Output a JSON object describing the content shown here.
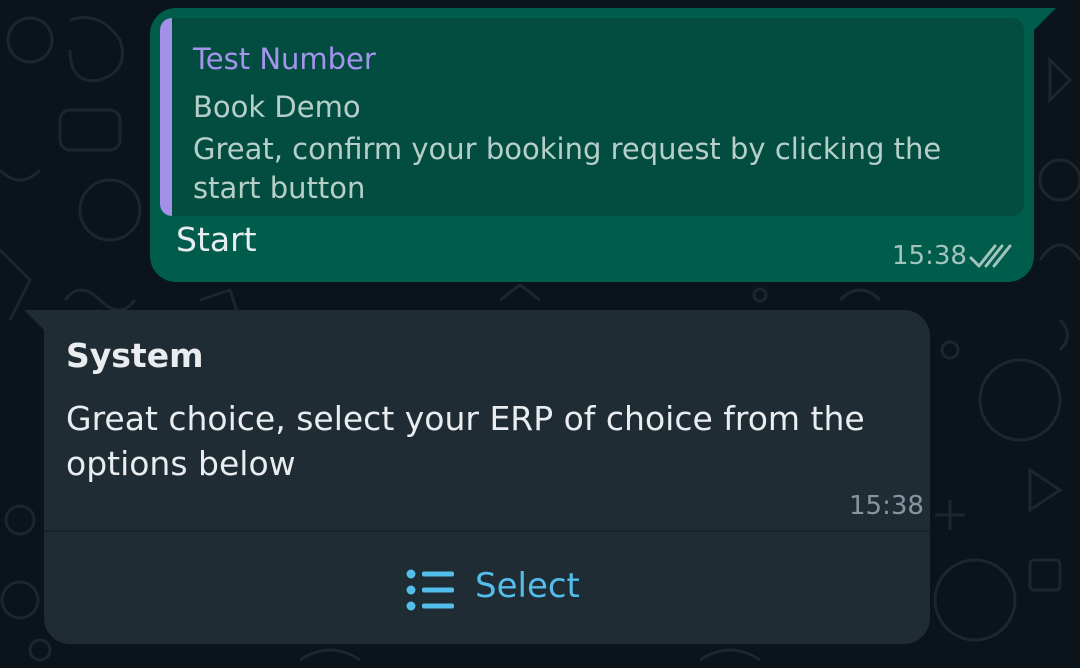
{
  "outgoing": {
    "quote": {
      "author": "Test Number",
      "title": "Book Demo",
      "body": "Great, confirm your booking request by clicking the start button"
    },
    "text": "Start",
    "time": "15:38",
    "status_icon": "double-check-icon"
  },
  "incoming": {
    "sender": "System",
    "text": "Great choice, select your ERP of choice from the options below",
    "time": "15:38",
    "button": {
      "label": "Select",
      "icon": "list-icon"
    }
  },
  "colors": {
    "background": "#0b141a",
    "outgoing_bubble": "#005c4b",
    "incoming_bubble": "#202c33",
    "quote_accent": "#a490e8",
    "button_text": "#53bdeb",
    "primary_text": "#e9edef"
  }
}
